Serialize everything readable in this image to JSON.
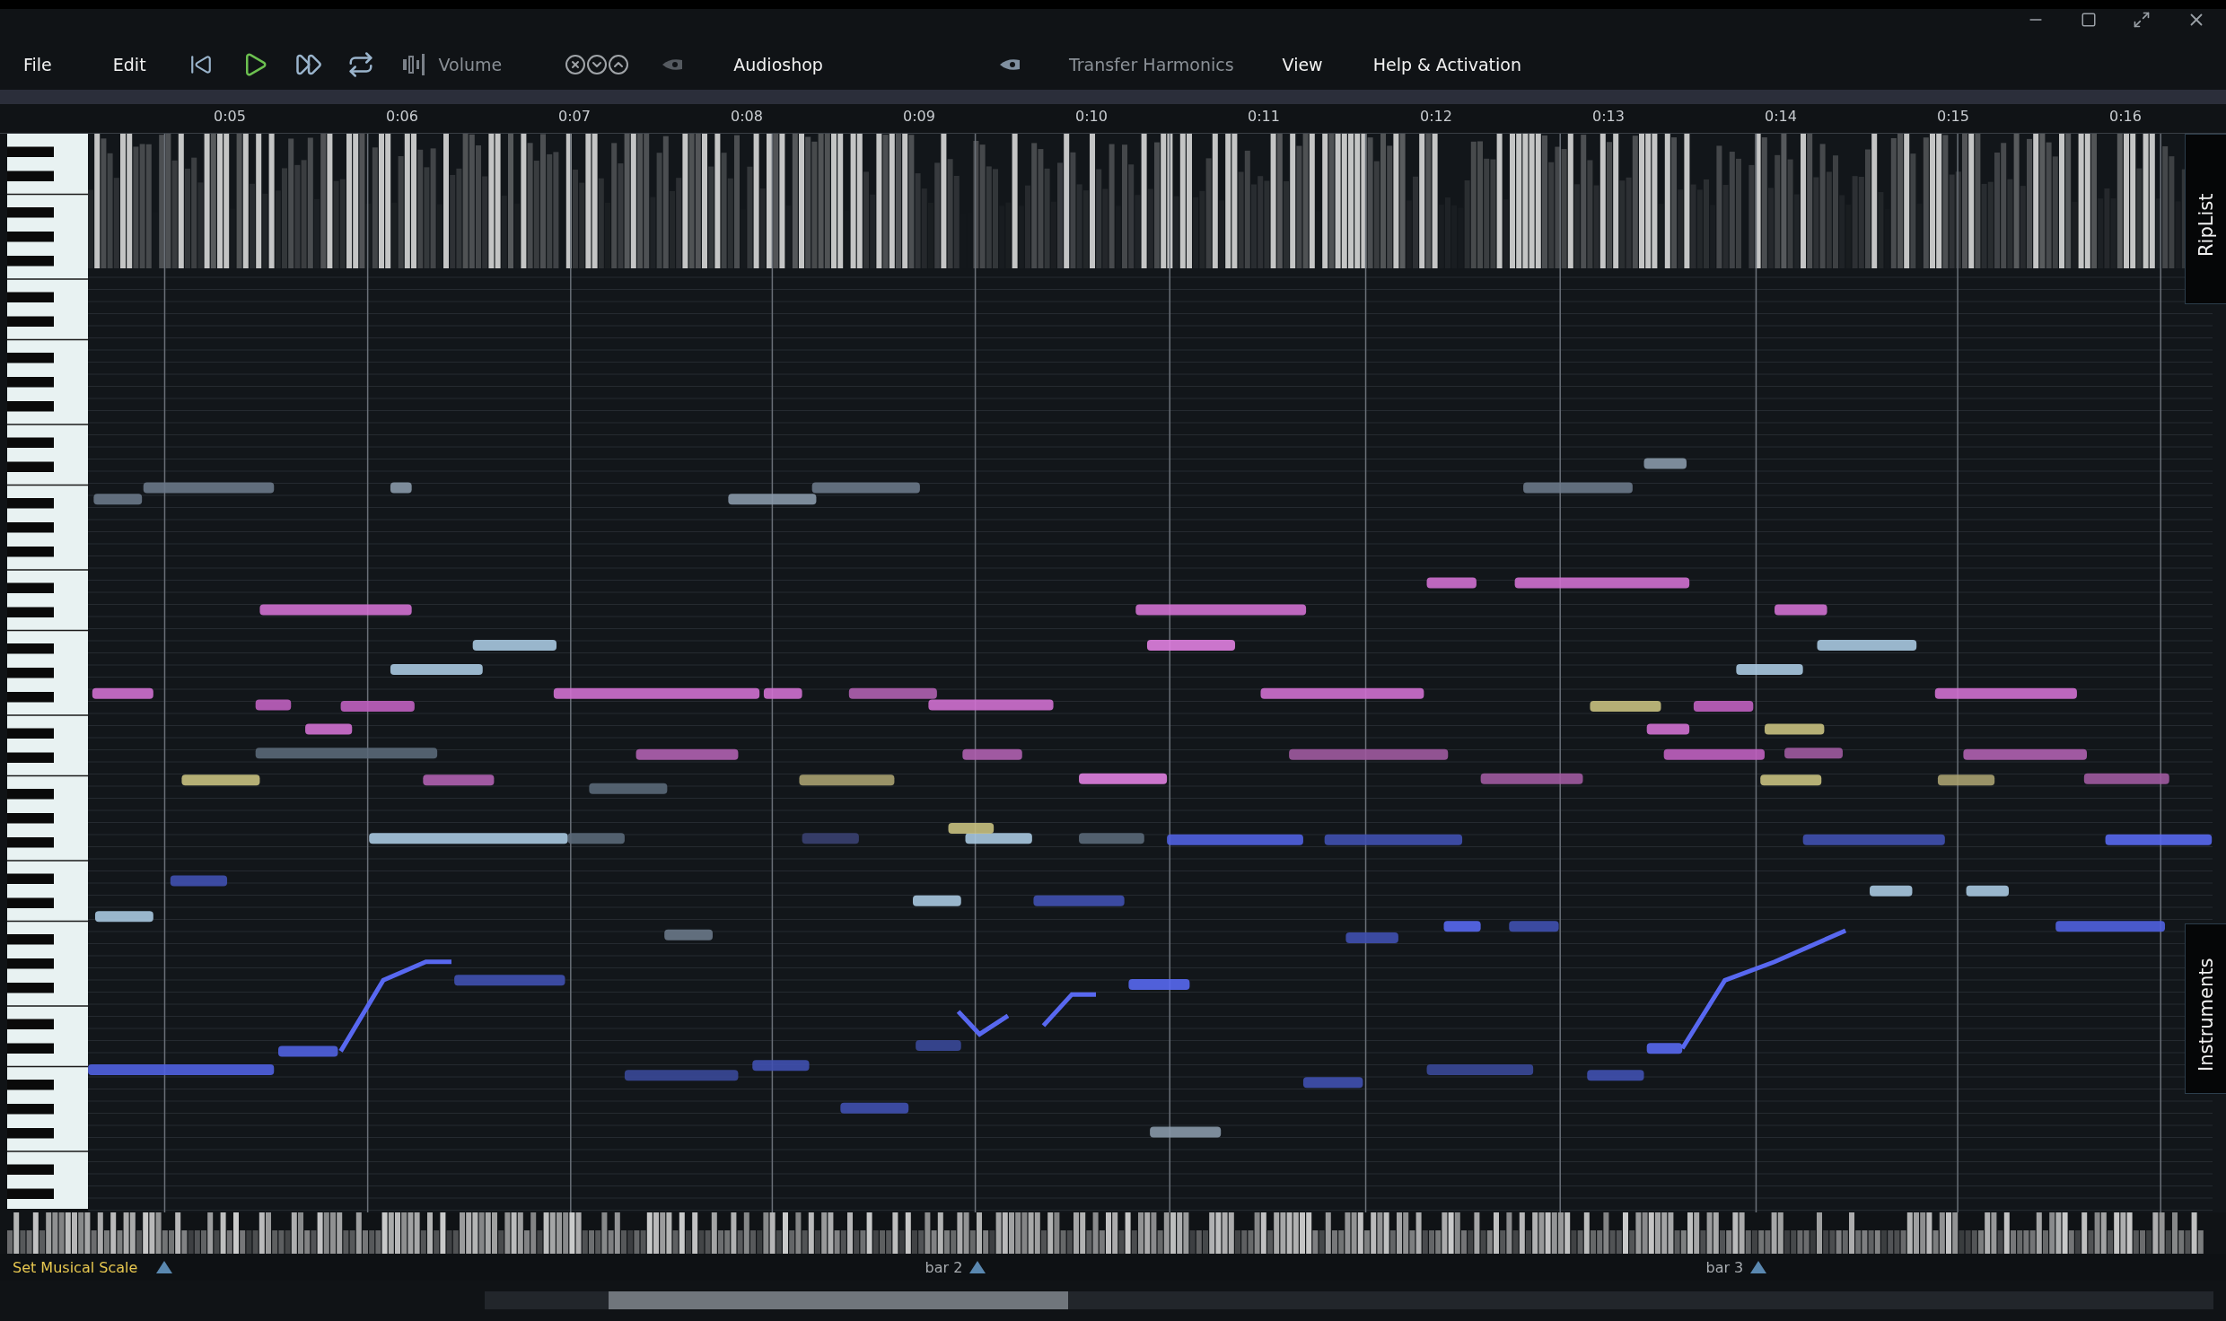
{
  "menus_left": [
    {
      "label": "File"
    },
    {
      "label": "Edit"
    }
  ],
  "volume": {
    "label": "Volume",
    "disabled": true
  },
  "audioshop": {
    "label": "Audioshop",
    "disabled": false
  },
  "transfer_harmonics": {
    "label": "Transfer Harmonics",
    "disabled": true
  },
  "menus_right": [
    {
      "label": "View"
    },
    {
      "label": "Help & Activation"
    }
  ],
  "ruler": {
    "ticks": [
      "0:05",
      "0:06",
      "0:07",
      "0:08",
      "0:09",
      "0:10",
      "0:11",
      "0:12",
      "0:13",
      "0:14",
      "0:15",
      "0:16"
    ]
  },
  "side_tabs": [
    {
      "label": "RipList"
    },
    {
      "label": "Instruments"
    }
  ],
  "footer": {
    "scale_button": "Set Musical Scale",
    "bar_markers": [
      {
        "label": "bar 2"
      },
      {
        "label": "bar 3"
      }
    ]
  }
}
